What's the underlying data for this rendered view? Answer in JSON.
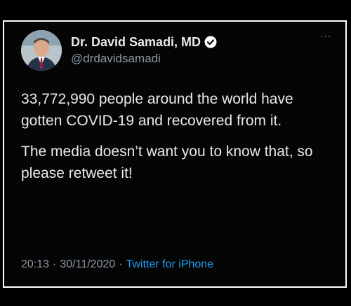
{
  "tweet": {
    "display_name": "Dr. David Samadi, MD",
    "handle": "@drdavidsamadi",
    "more_label": "...",
    "paragraph1": "33,772,990 people around the world have gotten COVID-19 and recovered from it.",
    "paragraph2": "The media doesn’t want you to know that, so please retweet it!",
    "time": "20:13",
    "date": "30/11/2020",
    "separator": "·",
    "source": "Twitter for iPhone"
  },
  "colors": {
    "background": "#000000",
    "tweet_bg": "#050505",
    "text": "#e7e9ea",
    "muted": "#8b98a5",
    "accent": "#1d9bf0",
    "border": "#ffffff"
  },
  "icons": {
    "avatar": "profile-photo",
    "verified": "verified-badge-icon",
    "more": "more-options-icon"
  }
}
